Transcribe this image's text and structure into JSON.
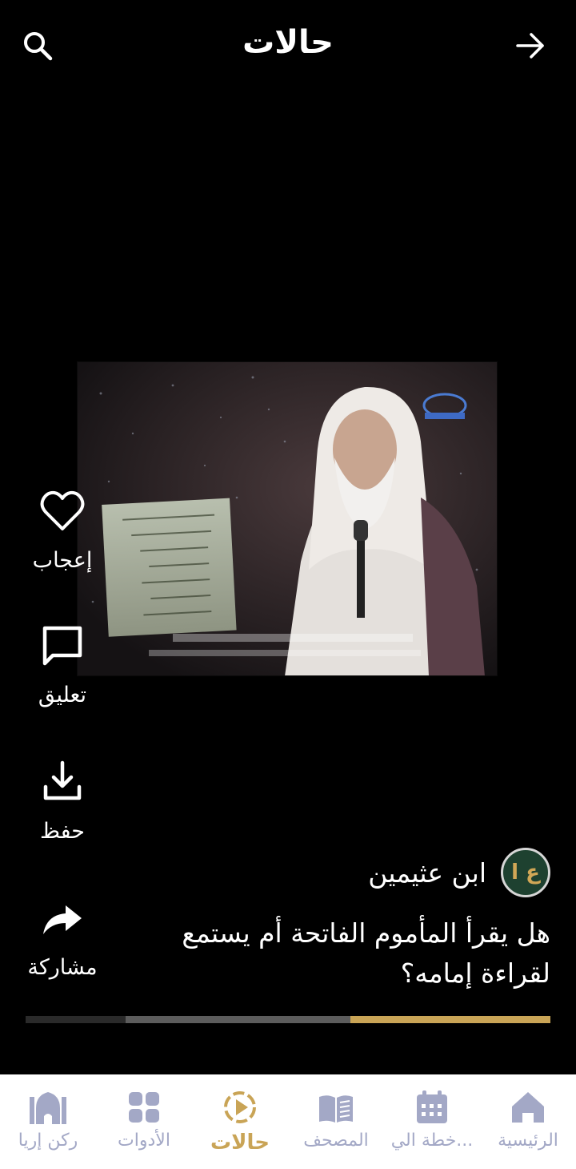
{
  "header": {
    "title": "حالات",
    "search_icon": "search-icon",
    "back_icon": "arrow-right-icon"
  },
  "actions": [
    {
      "label": "إعجاب",
      "icon": "heart-icon"
    },
    {
      "label": "تعليق",
      "icon": "comment-icon"
    },
    {
      "label": "حفظ",
      "icon": "download-icon"
    },
    {
      "label": "مشاركة",
      "icon": "share-icon"
    }
  ],
  "post": {
    "author": "ابن عثيمين",
    "avatar_text": "ع ا",
    "caption": "هل يقرأ المأموم الفاتحة أم يستمع لقراءة إمامه؟"
  },
  "progress": {
    "segments_total": 3,
    "active_segment_from_right": 1
  },
  "nav": {
    "items": [
      {
        "label": "الرئيسية",
        "icon": "home-icon"
      },
      {
        "label": "خطة الي...",
        "icon": "calendar-icon"
      },
      {
        "label": "المصحف",
        "icon": "book-icon"
      },
      {
        "label": "حالات",
        "icon": "play-circle-icon",
        "active": true
      },
      {
        "label": "الأدوات",
        "icon": "grid-icon"
      },
      {
        "label": "ركن إريا",
        "icon": "mosque-icon"
      }
    ]
  },
  "colors": {
    "accent": "#c9a456",
    "nav_inactive": "#a3a8c6",
    "background": "#000000"
  }
}
